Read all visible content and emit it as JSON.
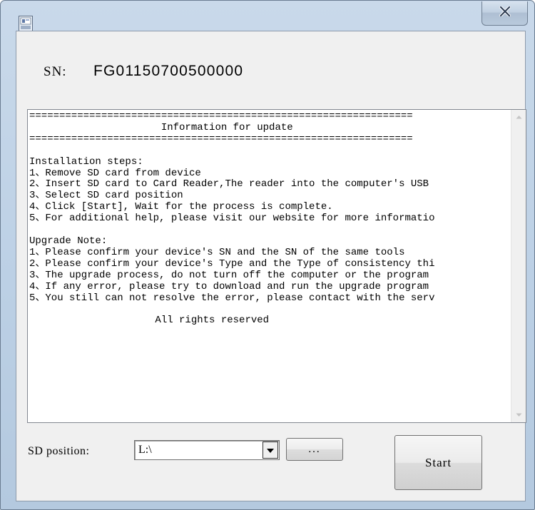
{
  "titlebar": {
    "icon": "app-icon",
    "close_label": "x"
  },
  "sn": {
    "label": "SN:",
    "value": "FG01150700500000"
  },
  "info": {
    "text": "================================================================\n                      Information for update\n================================================================\n\nInstallation steps:\n1、Remove SD card from device\n2、Insert SD card to Card Reader,The reader into the computer's USB\n3、Select SD card position\n4、Click [Start], Wait for the process is complete.\n5、For additional help, please visit our website for more informatio\n\nUpgrade Note:\n1、Please confirm your device's SN and the SN of the same tools\n2、Please confirm your device's Type and the Type of consistency thi\n3、The upgrade process, do not turn off the computer or the program\n4、If any error, please try to download and run the upgrade program\n5、You still can not resolve the error, please contact with the serv\n\n                     All rights reserved"
  },
  "controls": {
    "sd_position_label": "SD position:",
    "sd_position_value": "L:\\",
    "browse_label": "...",
    "start_label": "Start"
  },
  "colors": {
    "frame": "#bcd0e5",
    "client": "#f0f0f0"
  }
}
